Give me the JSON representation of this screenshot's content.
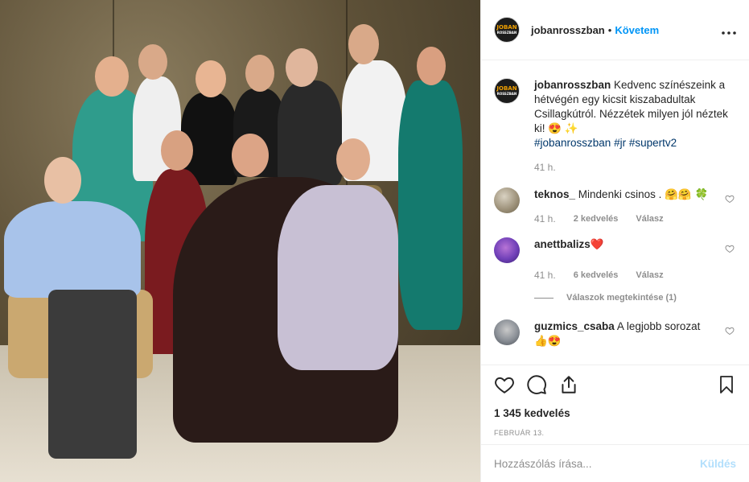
{
  "post": {
    "username": "jobanrosszban",
    "follow_label": "Követem",
    "separator": "•",
    "more_label": "•••",
    "avatar_logo_top": "JOBAN",
    "avatar_logo_bottom": "ROSSZBAN"
  },
  "caption": {
    "username": "jobanrosszban",
    "text": "Kedvenc színészeink a hétvégén egy kicsit kiszabadultak Csillagkútról. Nézzétek milyen jól néztek ki! 😍 ✨",
    "hashtags": "#jobanrosszban #jr #supertv2",
    "time": "41 h."
  },
  "comments": [
    {
      "username": "teknos_",
      "text": "Mindenki csinos . 🤗🤗 🍀",
      "time": "41 h.",
      "likes": "2 kedvelés",
      "reply": "Válasz"
    },
    {
      "username": "anettbalizs",
      "text": "❤️",
      "time": "41 h.",
      "likes": "6 kedvelés",
      "reply": "Válasz",
      "view_replies": "Válaszok megtekintése (1)"
    },
    {
      "username": "guzmics_csaba",
      "text": "A legjobb sorozat 👍😍"
    }
  ],
  "stats": {
    "likes": "1 345 kedvelés",
    "date": "FEBRUÁR 13."
  },
  "add_comment": {
    "placeholder": "Hozzászólás írása...",
    "send_label": "Küldés"
  },
  "icons": {
    "like": "heart-icon",
    "comment": "comment-icon",
    "share": "share-icon",
    "save": "bookmark-icon",
    "comment_like": "heart-outline-icon"
  },
  "colors": {
    "link": "#0095f6",
    "hashtag": "#00376b",
    "muted": "#8e8e8e",
    "send_disabled": "#b2dffc"
  }
}
